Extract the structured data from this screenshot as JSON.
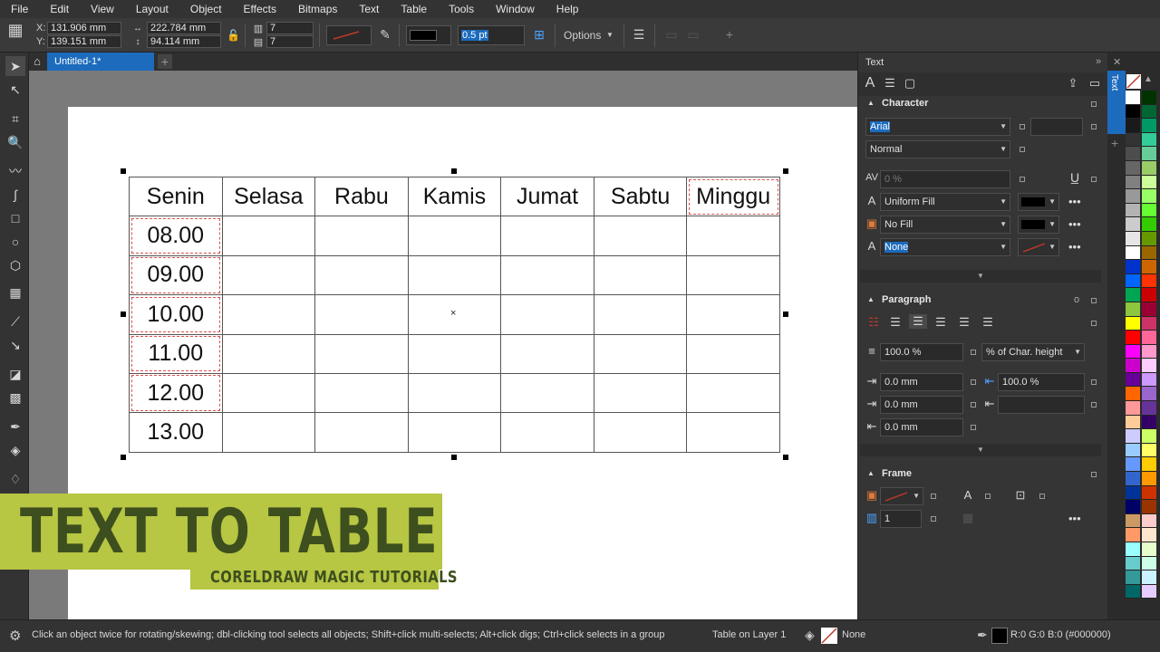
{
  "menu": [
    "File",
    "Edit",
    "View",
    "Layout",
    "Object",
    "Effects",
    "Bitmaps",
    "Text",
    "Table",
    "Tools",
    "Window",
    "Help"
  ],
  "propbar": {
    "x_label": "X:",
    "x_value": "131.906 mm",
    "y_label": "Y:",
    "y_value": "139.151 mm",
    "w_value": "222.784 mm",
    "h_value": "94.114 mm",
    "cols": "7",
    "rows": "7",
    "outline_width": "0.5 pt",
    "options_label": "Options"
  },
  "doc_tab": "Untitled-1*",
  "table": {
    "headers": [
      "Senin",
      "Selasa",
      "Rabu",
      "Kamis",
      "Jumat",
      "Sabtu",
      "Minggu"
    ],
    "times": [
      "08.00",
      "09.00",
      "10.00",
      "11.00",
      "12.00",
      "13.00"
    ]
  },
  "banner": {
    "title": "TEXT TO TABLE",
    "subtitle": "CORELDRAW MAGIC TUTORIALS"
  },
  "panel": {
    "title": "Text",
    "tab_label": "Text",
    "character": {
      "header": "Character",
      "font": "Arial",
      "style": "Normal",
      "kerning": "0 %",
      "fill": "Uniform Fill",
      "bg_fill": "No Fill",
      "outline": "None"
    },
    "paragraph": {
      "header": "Paragraph",
      "line_spacing": "100.0 %",
      "line_unit": "% of Char. height",
      "indent_first": "0.0 mm",
      "indent_right_pct": "100.0 %",
      "indent_left": "0.0 mm",
      "indent_right": "0.0 mm"
    },
    "frame": {
      "header": "Frame",
      "columns": "1"
    }
  },
  "palette_colors": [
    "#ffffff",
    "#000000",
    "#1a1a1a",
    "#333333",
    "#4d4d4d",
    "#666666",
    "#808080",
    "#999999",
    "#b3b3b3",
    "#cccccc",
    "#e6e6e6",
    "#ffffff",
    "#0033cc",
    "#0066ff",
    "#00a651",
    "#8dc63f",
    "#ffff00",
    "#ff0000",
    "#ff00ff",
    "#cc00cc",
    "#660099",
    "#ff6600",
    "#ff9999",
    "#ffcc99",
    "#ccccff",
    "#99ccff",
    "#6699ff",
    "#3366cc",
    "#003399",
    "#000066",
    "#cc9966",
    "#ff9966",
    "#99ffff",
    "#66cccc",
    "#339999",
    "#006666"
  ],
  "palette_colors2": [
    "#003300",
    "#006633",
    "#009966",
    "#33cc99",
    "#66cc99",
    "#99cc66",
    "#ccff99",
    "#99ff66",
    "#66ff33",
    "#33cc00",
    "#669900",
    "#996600",
    "#cc6600",
    "#ff3300",
    "#cc0000",
    "#990033",
    "#cc3366",
    "#ff6699",
    "#ff99cc",
    "#ffccff",
    "#cc99ff",
    "#9966cc",
    "#663399",
    "#330066",
    "#ccff66",
    "#ffff66",
    "#ffcc00",
    "#ff9900",
    "#cc3300",
    "#993300",
    "#ffcccc",
    "#ffe6cc",
    "#e6ffcc",
    "#ccffe6",
    "#ccf2ff",
    "#e6ccff"
  ],
  "status": {
    "hint": "Click an object twice for rotating/skewing; dbl-clicking tool selects all objects; Shift+click multi-selects; Alt+click digs; Ctrl+click selects in a group",
    "layer": "Table on Layer 1",
    "fill_none": "None",
    "color_readout": "R:0 G:0 B:0 (#000000)"
  }
}
